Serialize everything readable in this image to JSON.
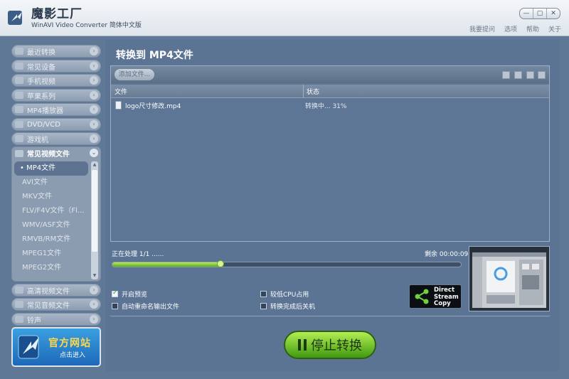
{
  "titlebar": {
    "app_name": "魔影工厂",
    "app_subtitle": "WinAVI Video Converter 简体中文版",
    "win_buttons": [
      "—",
      "▢",
      "✕"
    ],
    "menu": [
      "我要提问",
      "选项",
      "帮助",
      "关于"
    ]
  },
  "sidebar": {
    "categories_top": [
      "最近转换",
      "常见设备",
      "手机视频",
      "苹果系列",
      "MP4播放器",
      "DVD/VCD",
      "游戏机"
    ],
    "open_category": "常见视频文件",
    "sub_items": [
      "• MP4文件",
      "AVI文件",
      "MKV文件",
      "FLV/F4V文件（Fl...",
      "WMV/ASF文件",
      "RMVB/RM文件",
      "MPEG1文件",
      "MPEG2文件"
    ],
    "categories_bottom": [
      "高清视频文件",
      "常见音频文件",
      "铃声"
    ],
    "official_site": {
      "title": "官方网站",
      "subtitle": "点击进入"
    }
  },
  "main": {
    "title": "转换到 MP4文件",
    "add_file_label": "添加文件...",
    "columns": {
      "file": "文件",
      "status": "状态"
    },
    "file": {
      "name": "logo尺寸修改.mp4",
      "status": "转换中... 31%"
    },
    "processing_label": "正在处理 1/1 ......",
    "remaining_label": "剩余 00:00:09",
    "progress": 0.31,
    "options": {
      "preview": {
        "label": "开启预览",
        "checked": true
      },
      "auto_rename": {
        "label": "自动重命名输出文件",
        "checked": false
      },
      "low_cpu": {
        "label": "较低CPU占用",
        "checked": false
      },
      "shutdown": {
        "label": "转换完成后关机",
        "checked": false
      }
    },
    "direct_stream_copy": "Direct\nStream\nCopy",
    "stop_label": "停止转换"
  },
  "colors": {
    "accent_green": "#5ea81c",
    "panel_blue": "#5b7494",
    "site_gold": "#ffd84a"
  }
}
